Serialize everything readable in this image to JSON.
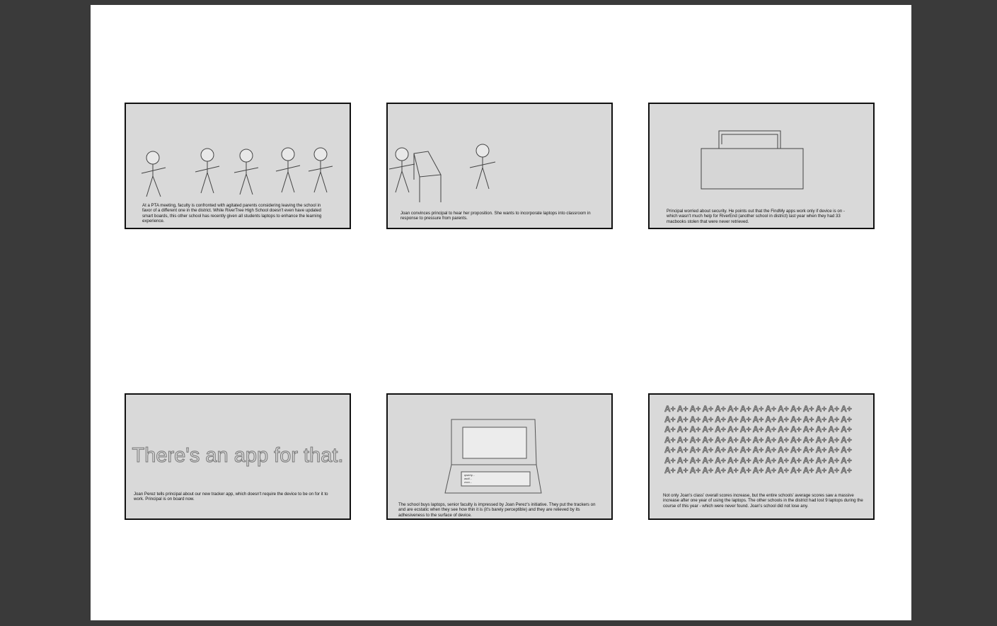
{
  "panels": [
    {
      "caption": "At a PTA meeting, faculty is confronted with agitated parents considering leaving the school in favor of a different one in the district. While RiverTree High School doesn't even have updated smart boards, this other school has recently given all students laptops to enhance the learning experience."
    },
    {
      "caption": "Joan convinces principal to hear her proposition. She wants to incorporate laptops into classroom in response to pressure from parents."
    },
    {
      "caption": "Principal worried about security. He points out that the FindMy apps work only if device is on - which wasn't much help for RiverEnd (another school in district) last year when they had 33 macbooks stolen that were never retrieved."
    },
    {
      "headline": "There's an app for that.",
      "caption": "Joan Perez tells principal about our new tracker app, which doesn't require the device to be on for it to work. Principal is on board now."
    },
    {
      "screen_lines": [
        "qwerty...",
        "asdf...",
        "zxcv..."
      ],
      "caption": "The school buys laptops, senior faculty is impressed by Joan Perez's initiative. They put the trackers on and are ecstatic when they see how thin it is (it's barely perceptible) and they are relieved by its adhesiveness to the surface of device."
    },
    {
      "grade": "A+",
      "grade_count": 105,
      "caption": "Not only Joan's class' overall scores increase, but the entire schools' average scores saw a massive increase after one year of using the laptops. The other schools in the district had lost 9 laptops during the course of this year - which were never found. Joan's school did not lose any."
    }
  ]
}
